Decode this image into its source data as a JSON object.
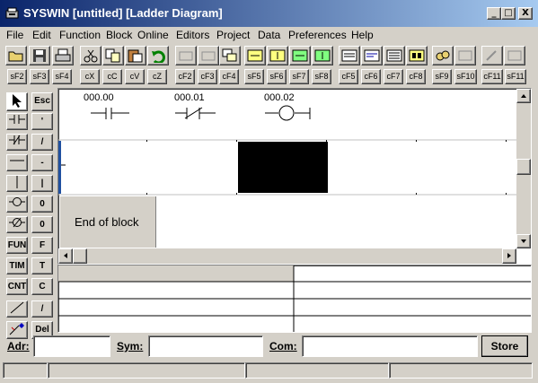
{
  "window": {
    "title": "SYSWIN [untitled] [Ladder Diagram]",
    "min": "_",
    "max": "□",
    "close": "X"
  },
  "menu": [
    "File",
    "Edit",
    "Function",
    "Block",
    "Online",
    "Editors",
    "Project",
    "Data",
    "Preferences",
    "Help"
  ],
  "fkeys": [
    "sF2",
    "sF3",
    "sF4",
    "cX",
    "cC",
    "cV",
    "cZ",
    "cF2",
    "cF3",
    "cF4",
    "sF5",
    "sF6",
    "sF7",
    "sF8",
    "cF5",
    "cF6",
    "cF7",
    "cF8",
    "sF9",
    "sF10",
    "cF11",
    "sF11"
  ],
  "palette": {
    "right": [
      "Esc",
      "'",
      "/",
      "-",
      "|",
      "0",
      "0",
      "F",
      "T",
      "C",
      "/",
      "Del"
    ],
    "left": [
      "FUN",
      "TIM",
      "CNT"
    ]
  },
  "ladder": {
    "contacts": [
      "000.00",
      "000.01",
      "000.02"
    ],
    "end_block": "End of block"
  },
  "bottom": {
    "adr_label": "Adr:",
    "sym_label": "Sym:",
    "com_label": "Com:",
    "store_label": "Store",
    "adr_value": "",
    "sym_value": "",
    "com_value": ""
  }
}
